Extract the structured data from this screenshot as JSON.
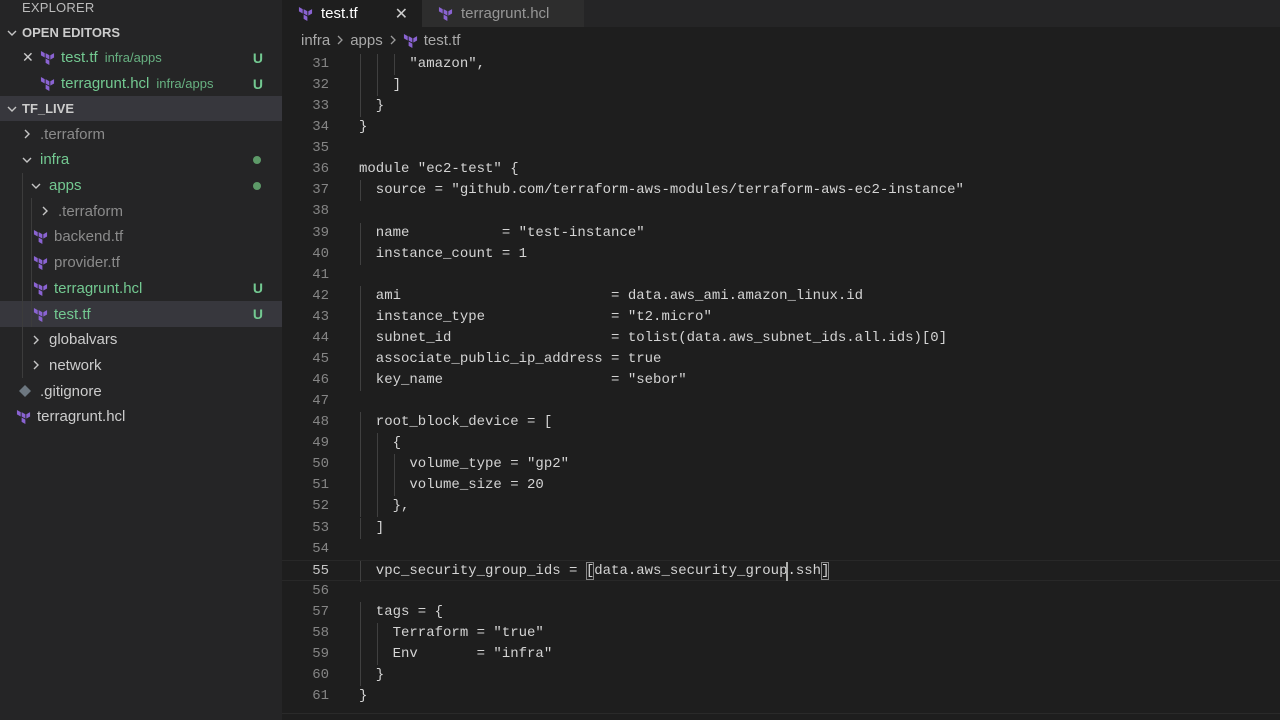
{
  "sidebar": {
    "title": "EXPLORER",
    "open_editors": {
      "header": "OPEN EDITORS",
      "items": [
        {
          "name": "test.tf",
          "path": "infra/apps",
          "status": "U"
        },
        {
          "name": "terragrunt.hcl",
          "path": "infra/apps",
          "status": "U"
        }
      ]
    },
    "workspace": {
      "header": "TF_LIVE",
      "tree": [
        {
          "label": ".terraform"
        },
        {
          "label": "infra"
        },
        {
          "label": "apps"
        },
        {
          "label": ".terraform"
        },
        {
          "label": "backend.tf"
        },
        {
          "label": "provider.tf"
        },
        {
          "label": "terragrunt.hcl",
          "status": "U"
        },
        {
          "label": "test.tf",
          "status": "U"
        },
        {
          "label": "globalvars"
        },
        {
          "label": "network"
        },
        {
          "label": ".gitignore"
        },
        {
          "label": "terragrunt.hcl"
        }
      ]
    }
  },
  "tabs": [
    {
      "label": "test.tf",
      "active": true,
      "close": "✕"
    },
    {
      "label": "terragrunt.hcl",
      "active": false
    }
  ],
  "breadcrumb": [
    "infra",
    "apps",
    "test.tf"
  ],
  "editor": {
    "lines": [
      {
        "n": "31",
        "text": "      \"amazon\","
      },
      {
        "n": "32",
        "text": "    ]"
      },
      {
        "n": "33",
        "text": "  }"
      },
      {
        "n": "34",
        "text": "}"
      },
      {
        "n": "35",
        "text": ""
      },
      {
        "n": "36",
        "text": "module \"ec2-test\" {"
      },
      {
        "n": "37",
        "text": "  source = \"github.com/terraform-aws-modules/terraform-aws-ec2-instance\""
      },
      {
        "n": "38",
        "text": ""
      },
      {
        "n": "39",
        "text": "  name           = \"test-instance\""
      },
      {
        "n": "40",
        "text": "  instance_count = 1"
      },
      {
        "n": "41",
        "text": ""
      },
      {
        "n": "42",
        "text": "  ami                         = data.aws_ami.amazon_linux.id"
      },
      {
        "n": "43",
        "text": "  instance_type               = \"t2.micro\""
      },
      {
        "n": "44",
        "text": "  subnet_id                   = tolist(data.aws_subnet_ids.all.ids)[0]"
      },
      {
        "n": "45",
        "text": "  associate_public_ip_address = true"
      },
      {
        "n": "46",
        "text": "  key_name                    = \"sebor\""
      },
      {
        "n": "47",
        "text": ""
      },
      {
        "n": "48",
        "text": "  root_block_device = ["
      },
      {
        "n": "49",
        "text": "    {"
      },
      {
        "n": "50",
        "text": "      volume_type = \"gp2\""
      },
      {
        "n": "51",
        "text": "      volume_size = 20"
      },
      {
        "n": "52",
        "text": "    },"
      },
      {
        "n": "53",
        "text": "  ]"
      },
      {
        "n": "54",
        "text": ""
      },
      {
        "n": "55",
        "text": "  vpc_security_group_ids = [data.aws_security_group.ssh]"
      },
      {
        "n": "56",
        "text": ""
      },
      {
        "n": "57",
        "text": "  tags = {"
      },
      {
        "n": "58",
        "text": "    Terraform = \"true\""
      },
      {
        "n": "59",
        "text": "    Env       = \"infra\""
      },
      {
        "n": "60",
        "text": "  }"
      },
      {
        "n": "61",
        "text": "}"
      }
    ],
    "current_line": "55"
  },
  "colors": {
    "sidebar_bg": "#252526",
    "editor_bg": "#1e1e1e",
    "untracked_green": "#73c991",
    "terraform_purple": "#8a63d2",
    "selection_bg": "#37373d"
  }
}
